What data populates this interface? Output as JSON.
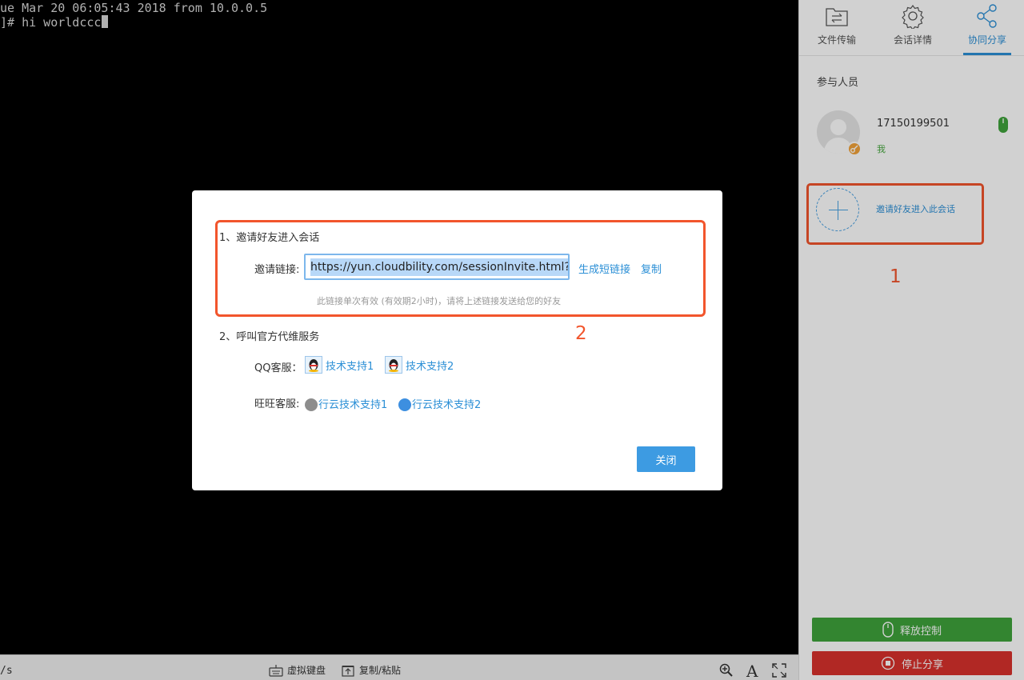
{
  "terminal": {
    "line1": "ue Mar 20 06:05:43 2018 from 10.0.0.5",
    "line2": "]# hi worldccc"
  },
  "statusbar": {
    "left_text": "/s",
    "virtual_keyboard_label": "虚拟键盘",
    "copy_paste_label": "复制/粘贴",
    "font_icon_glyph": "A"
  },
  "sidepanel": {
    "tabs": [
      {
        "label": "文件传输",
        "icon": "file-transfer-icon"
      },
      {
        "label": "会话详情",
        "icon": "gear-icon"
      },
      {
        "label": "协同分享",
        "icon": "share-icon",
        "active": true
      }
    ],
    "participants_title": "参与人员",
    "participant": {
      "name": "17150199501",
      "role": "我"
    },
    "invite_text": "邀请好友进入此会话",
    "release_control_label": "释放控制",
    "stop_share_label": "停止分享"
  },
  "annotations": {
    "one": "1",
    "two": "2"
  },
  "modal": {
    "section1_title": "1、邀请好友进入会话",
    "invite_link_label": "邀请链接:",
    "invite_link_value": "https://yun.cloudbility.com/sessionInvite.html?tk",
    "generate_short_link": "生成短链接",
    "copy_label": "复制",
    "hint": "此链接单次有效 (有效期2小时)，请将上述链接发送给您的好友",
    "section2_title": "2、呼叫官方代维服务",
    "qq_label": "QQ客服：",
    "qq_links": [
      "技术支持1",
      "技术支持2"
    ],
    "wangwang_label": "旺旺客服:",
    "wangwang_links": [
      "行云技术支持1",
      "行云技术支持2"
    ],
    "close_label": "关闭"
  },
  "colors": {
    "accent_blue": "#2b8fd6",
    "annotation_red": "#f2552c",
    "release_green": "#3fa33b",
    "stop_red": "#d8312d",
    "close_button": "#3d9be2"
  }
}
